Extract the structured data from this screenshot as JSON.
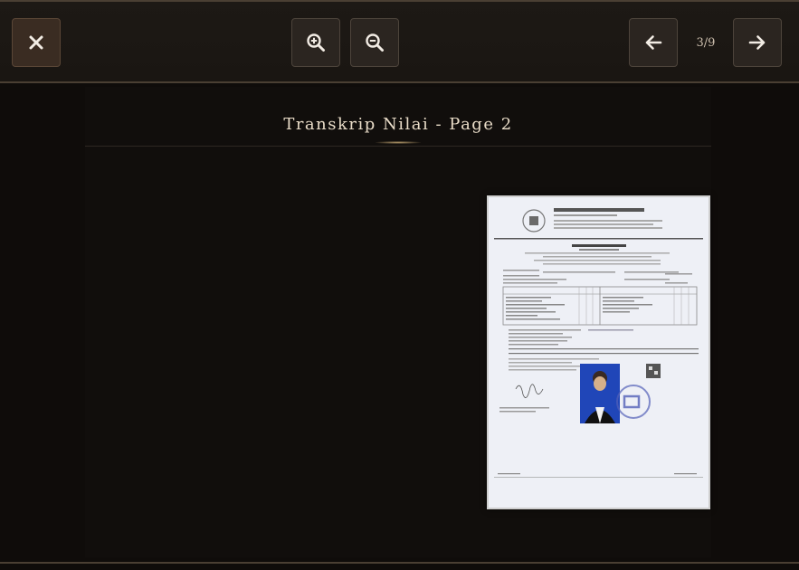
{
  "toolbar": {
    "close_icon": "close-icon",
    "zoom_in_icon": "zoom-in-icon",
    "zoom_out_icon": "zoom-out-icon",
    "prev_icon": "arrow-left-icon",
    "next_icon": "arrow-right-icon",
    "page_counter": "3/9"
  },
  "viewer": {
    "page_title": "Transkrip Nilai - Page 2"
  },
  "colors": {
    "background": "#0f0c0a",
    "toolbar": "#1d1915",
    "button": "#2b2520",
    "title_text": "#e9dcc8"
  }
}
